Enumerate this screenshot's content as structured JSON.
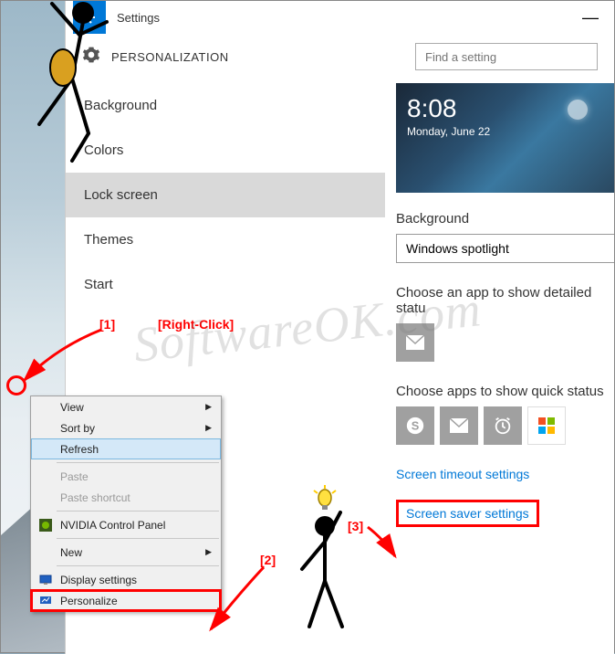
{
  "window": {
    "title": "Settings",
    "header": "PERSONALIZATION",
    "search_placeholder": "Find a setting"
  },
  "sidebar": {
    "items": [
      {
        "label": "Background"
      },
      {
        "label": "Colors"
      },
      {
        "label": "Lock screen",
        "selected": true
      },
      {
        "label": "Themes"
      },
      {
        "label": "Start"
      }
    ]
  },
  "preview": {
    "time": "8:08",
    "date": "Monday, June 22"
  },
  "content": {
    "background_label": "Background",
    "background_value": "Windows spotlight",
    "detailed_label": "Choose an app to show detailed statu",
    "quickstatus_label": "Choose apps to show quick status",
    "link_timeout": "Screen timeout settings",
    "link_saver": "Screen saver settings"
  },
  "context_menu": {
    "items": [
      {
        "label": "View",
        "sub": true
      },
      {
        "label": "Sort by",
        "sub": true
      },
      {
        "label": "Refresh",
        "hover": true
      },
      {
        "sep": true
      },
      {
        "label": "Paste",
        "disabled": true
      },
      {
        "label": "Paste shortcut",
        "disabled": true
      },
      {
        "sep": true
      },
      {
        "label": "NVIDIA Control Panel",
        "icon": "nvidia"
      },
      {
        "sep": true
      },
      {
        "label": "New",
        "sub": true
      },
      {
        "sep": true
      },
      {
        "label": "Display settings",
        "icon": "display"
      },
      {
        "label": "Personalize",
        "icon": "personalize",
        "boxed": true
      }
    ]
  },
  "annotations": {
    "n1": "[1]",
    "n2": "[2]",
    "n3": "[3]",
    "rightclick": "[Right-Click]"
  },
  "watermark": "SoftwareOK.com"
}
